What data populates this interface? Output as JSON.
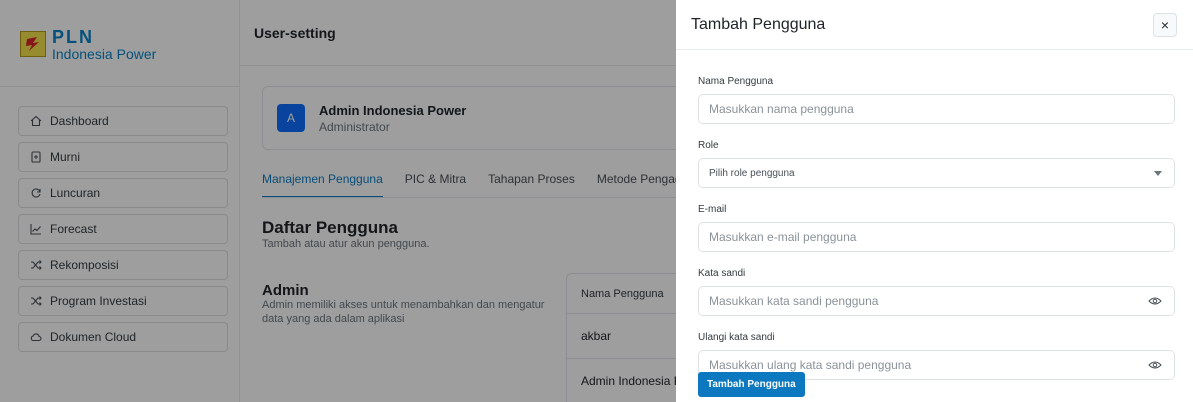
{
  "brand": {
    "name": "PLN",
    "sub": "Indonesia Power"
  },
  "sidebar": {
    "items": [
      {
        "label": "Dashboard",
        "icon": "home-icon"
      },
      {
        "label": "Murni",
        "icon": "document-icon"
      },
      {
        "label": "Luncuran",
        "icon": "refresh-icon"
      },
      {
        "label": "Forecast",
        "icon": "chart-line-icon"
      },
      {
        "label": "Rekomposisi",
        "icon": "shuffle-icon"
      },
      {
        "label": "Program Investasi",
        "icon": "shuffle-icon"
      },
      {
        "label": "Dokumen Cloud",
        "icon": "cloud-icon"
      }
    ]
  },
  "header": {
    "title": "User-setting"
  },
  "profile": {
    "initial": "A",
    "name": "Admin Indonesia Power",
    "role": "Administrator"
  },
  "tabs": [
    "Manajemen Pengguna",
    "PIC & Mitra",
    "Tahapan Proses",
    "Metode Pengadaa"
  ],
  "section": {
    "title": "Daftar Pengguna",
    "subtitle": "Tambah atau atur akun pengguna."
  },
  "admin": {
    "title": "Admin",
    "description": "Admin memiliki akses untuk menambahkan dan mengatur data yang ada dalam aplikasi"
  },
  "table": {
    "header": "Nama Pengguna",
    "rows": [
      "akbar",
      "Admin Indonesia P"
    ]
  },
  "drawer": {
    "title": "Tambah Pengguna",
    "close": "×",
    "fields": {
      "name": {
        "label": "Nama Pengguna",
        "placeholder": "Masukkan nama pengguna"
      },
      "role": {
        "label": "Role",
        "placeholder": "Pilih role pengguna"
      },
      "email": {
        "label": "E-mail",
        "placeholder": "Masukkan e-mail pengguna"
      },
      "password": {
        "label": "Kata sandi",
        "placeholder": "Masukkan kata sandi pengguna"
      },
      "confirm": {
        "label": "Ulangi kata sandi",
        "placeholder": "Masukkan ulang kata sandi pengguna"
      }
    },
    "submit": "Tambah Pengguna"
  },
  "colors": {
    "accent": "#0b78bf",
    "brand": "#0b84c7",
    "overlay": "rgba(0,0,0,0.38)"
  }
}
